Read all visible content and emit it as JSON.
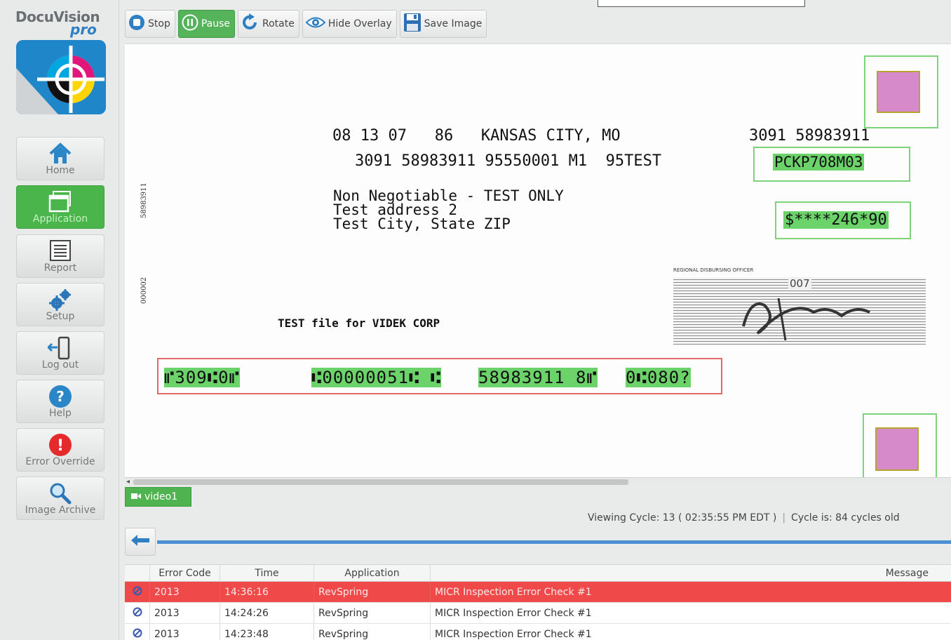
{
  "brand": {
    "name": "DocuVision",
    "suffix": "pro"
  },
  "sidebar": {
    "items": [
      {
        "label": "Home",
        "icon": "home-icon",
        "active": false
      },
      {
        "label": "Application",
        "icon": "application-window-icon",
        "active": true
      },
      {
        "label": "Report",
        "icon": "report-list-icon",
        "active": false
      },
      {
        "label": "Setup",
        "icon": "gears-icon",
        "active": false
      },
      {
        "label": "Log out",
        "icon": "logout-door-icon",
        "active": false
      },
      {
        "label": "Help",
        "icon": "help-question-icon",
        "active": false
      },
      {
        "label": "Error Override",
        "icon": "error-exclamation-icon",
        "active": false
      },
      {
        "label": "Image Archive",
        "icon": "magnifier-icon",
        "active": false
      }
    ]
  },
  "toolbar": {
    "stop": "Stop",
    "pause": "Pause",
    "rotate": "Rotate",
    "hide_overlay": "Hide Overlay",
    "save_image": "Save Image"
  },
  "document": {
    "header_line": "08 13 07   86   KANSAS CITY, MO",
    "header_right": "3091 58983911",
    "line2": "3091 58983911 95550001 M1  95TEST",
    "field_code": "PCKP708M03",
    "address": [
      "Non Negotiable - TEST ONLY",
      "Test address 2",
      "Test City, State ZIP"
    ],
    "amount": "$****246*90",
    "side_number_1": "58983911",
    "side_number_2": "000002",
    "test_file": "TEST file for VIDEK CORP",
    "officer_label": "REGIONAL DISBURSING OFFICER",
    "signature_number": "007",
    "micr": {
      "group1": "⑈309⑆0⑈",
      "group2": "⑆00000051⑆ ⑆",
      "group3": "58983911 8⑈",
      "group4": "0⑆080?"
    }
  },
  "video_tab": "video1",
  "status": {
    "viewing": "Viewing Cycle: 13 ( 02:35:55 PM EDT )",
    "cycle_age": "Cycle is: 84 cycles old"
  },
  "table": {
    "headers": [
      "Error Code",
      "Time",
      "Application",
      "Message"
    ],
    "rows": [
      {
        "code": "2013",
        "time": "14:36:16",
        "app": "RevSpring",
        "message": "MICR Inspection Error Check #1",
        "alert": true
      },
      {
        "code": "2013",
        "time": "14:24:26",
        "app": "RevSpring",
        "message": "MICR Inspection Error Check #1",
        "alert": false
      },
      {
        "code": "2013",
        "time": "14:23:48",
        "app": "RevSpring",
        "message": "MICR Inspection Error Check #1",
        "alert": false
      }
    ]
  },
  "colors": {
    "accent_green": "#4fb44f",
    "alert_red": "#f0494a",
    "brand_blue": "#1f86c9",
    "timeline_blue": "#4f8fd4"
  }
}
